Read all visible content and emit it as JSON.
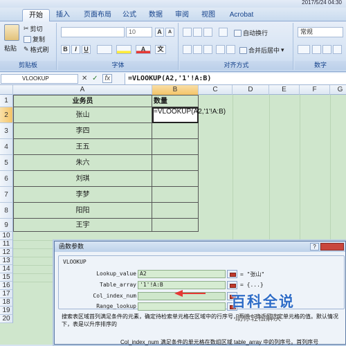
{
  "title": "2017/5/24 04:30",
  "tabs": [
    {
      "label": "开始",
      "active": true
    },
    {
      "label": "插入"
    },
    {
      "label": "页面布局"
    },
    {
      "label": "公式"
    },
    {
      "label": "数据"
    },
    {
      "label": "审阅"
    },
    {
      "label": "视图"
    },
    {
      "label": "Acrobat"
    }
  ],
  "ribbon": {
    "clipboard": {
      "paste": "粘贴",
      "cut": "剪切",
      "copy": "复制",
      "painter": "格式刷",
      "label": "剪贴板"
    },
    "font": {
      "size": "10",
      "label": "字体",
      "bold": "B",
      "italic": "I",
      "underline": "U",
      "grow": "A",
      "shrink": "A",
      "wen": "文"
    },
    "align": {
      "wrap": "自动换行",
      "merge": "合并后居中",
      "label": "对齐方式"
    },
    "number": {
      "format": "常规",
      "label": "数字"
    }
  },
  "formula_bar": {
    "name_box": "VLOOKUP",
    "cancel": "✕",
    "enter": "✓",
    "fx": "fx",
    "formula": "=VLOOKUP(A2,'1'!A:B)"
  },
  "columns": [
    "A",
    "B",
    "C",
    "D",
    "E",
    "F",
    "G"
  ],
  "rows": [
    "1",
    "2",
    "3",
    "4",
    "5",
    "6",
    "7",
    "8",
    "9",
    "10",
    "11",
    "12",
    "13",
    "14",
    "15",
    "16",
    "17",
    "18",
    "19",
    "20"
  ],
  "sheet": {
    "header_a": "业务员",
    "header_b": "数量",
    "b2_edit": "=VLOOKUP(A2,'1'!A:B)",
    "names": [
      "张山",
      "李四",
      "王五",
      "朱六",
      "刘琪",
      "李梦",
      "阳阳",
      "王宇"
    ]
  },
  "dialog": {
    "title": "函数参数",
    "help": "?",
    "function": "VLOOKUP",
    "args": [
      {
        "label": "Lookup_value",
        "value": "A2",
        "result": "= \"张山\""
      },
      {
        "label": "Table_array",
        "value": "'1'!A:B",
        "result": "= {...}"
      },
      {
        "label": "Col_index_num",
        "value": "",
        "result": "="
      },
      {
        "label": "Range_lookup",
        "value": "",
        "result": "="
      }
    ],
    "description": "搜索表区域首列满足条件的元素，确定待检索单元格在区域中的行序号，再进一步返回选定单元格的值。默认情况下，表是以升序排序的",
    "hint": "Col_index_num  满足条件的单元格在数组区域 table_array 中的列序号。首列序号"
  },
  "watermark": {
    "brand": "百科全说",
    "tagline": "助你轻松解决"
  }
}
